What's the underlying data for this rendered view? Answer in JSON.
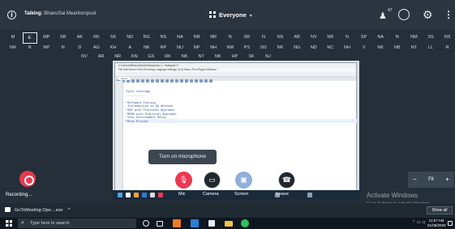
{
  "meeting_header": {
    "talking_label": "Talking:",
    "talking_names": "BhanuSai Meantorspool",
    "view_label": "Everyone",
    "attendee_count": "47"
  },
  "attendees": {
    "row1": [
      "M",
      "E",
      "MP",
      "SR",
      "AK",
      "RK",
      "SK",
      "ND",
      "RG",
      "NS",
      "NA",
      "NR",
      "NR",
      "N",
      "SR",
      "N",
      "NS",
      "AB",
      "NV",
      "NR",
      "N",
      "SP",
      "NA",
      "N",
      "NM",
      "SS",
      "NS"
    ],
    "row2": [
      "NR",
      "N",
      "NP",
      "N",
      "D",
      "AG",
      "KH",
      "A",
      "NK",
      "RP",
      "NU",
      "NP",
      "NH",
      "NM",
      "PS",
      "NS",
      "NK",
      "NG",
      "ND",
      "NC",
      "NH",
      "V",
      "NK",
      "NB",
      "NT",
      "LL",
      "R"
    ],
    "row3": [
      "NV",
      "AR",
      "NR",
      "KN",
      "GS",
      "RK",
      "NK",
      "NT",
      "NK",
      "HP",
      "SK",
      "NJ"
    ],
    "active_index": 1
  },
  "shared_screen": {
    "window_title": "C:\\Users\\BhanuSai\\Desktop\\new 2 - Notepad++",
    "menu": "File  Edit  Search  View  Encoding  Language  Settings  Tools  Macro  Run  Plugins  Window  ?",
    "tab": "new 2",
    "code_lines": [
      "Topic Coverage",
      "-----------",
      "",
      "*Software Testing",
      "  -Introduction to QA methods",
      "*SDE with Practical Approach",
      "*MERN with Practical Approach",
      "*Test Environment Setup",
      "*Mini Project"
    ],
    "overlay_labels": [
      "Mic",
      "Camera",
      "Screen",
      "Leave"
    ]
  },
  "controls": {
    "mic_tooltip": "Turn on microphone",
    "recording_label": "Recording..."
  },
  "zoom": {
    "minus": "−",
    "value": "Fit",
    "plus": "+"
  },
  "watermark": {
    "title": "Activate Windows",
    "subtitle": "Go to Settings to activate Windows."
  },
  "gtm_tray": {
    "item_label": "GoToMeeting Ope....exe",
    "show_all": "Show all"
  },
  "taskbar": {
    "search_placeholder": "Type here to search",
    "time": "11:57 AM",
    "date": "01/08/2020"
  },
  "colors": {
    "accent_red": "#e8394f",
    "header_bg": "#2a3540",
    "stage_bg": "#242f39",
    "taskbar_bg": "#0f1720"
  },
  "icons": {
    "info": "info-icon",
    "view": "grid-icon",
    "attendees": "people-icon",
    "chat": "chat-icon",
    "settings": "gear-icon",
    "more": "kebab-icon",
    "mic": "mic-off-icon",
    "camera": "camera-off-icon",
    "screen": "screen-share-icon",
    "leave": "phone-hangup-icon"
  }
}
